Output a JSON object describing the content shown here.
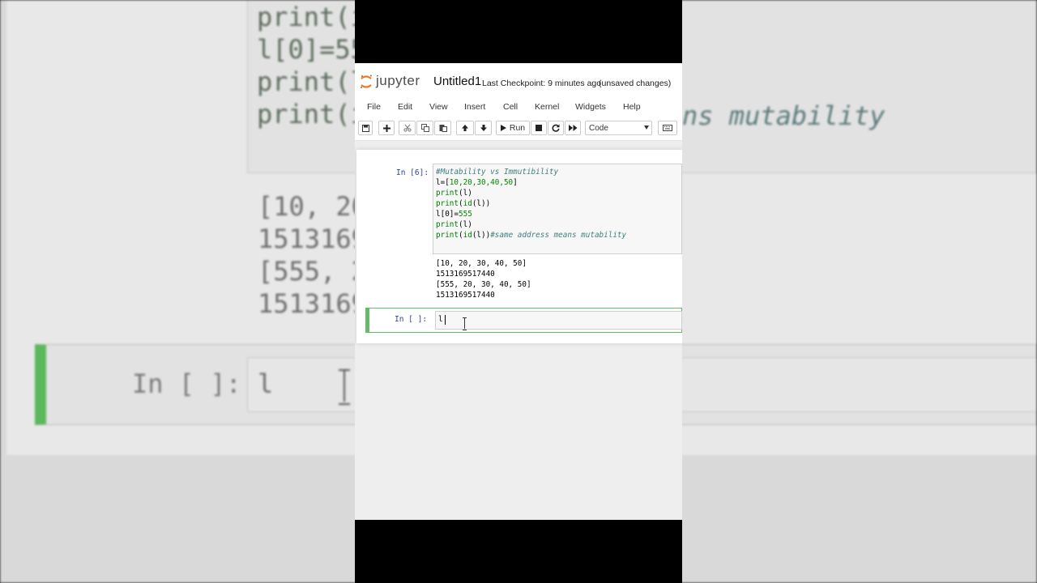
{
  "backdrop": {
    "code_lines": [
      "print(i",
      "l[0]=55",
      "print(l",
      "print(i"
    ],
    "comment_fragment": "ns mutability",
    "output_lines": [
      "[10, 20",
      "1513169",
      "[555, 2",
      "1513169"
    ],
    "prompt": "In [ ]:",
    "input": "l"
  },
  "header": {
    "logo_text": "jupyter",
    "notebook_title": "Untitled1",
    "checkpoint": "Last Checkpoint: 9 minutes ago",
    "status": "(unsaved changes)"
  },
  "menu": [
    "File",
    "Edit",
    "View",
    "Insert",
    "Cell",
    "Kernel",
    "Widgets",
    "Help"
  ],
  "toolbar": {
    "run_label": "Run",
    "cell_type": "Code"
  },
  "cells": [
    {
      "prompt": "In [6]:",
      "code": {
        "line1": "#Mutability vs Immutibility",
        "line2_a": "l=[",
        "line2_nums": "10,20,30,40,50",
        "line2_b": "]",
        "line3_fn": "print",
        "line3_rest": "(l)",
        "line4_fn": "print",
        "line4_mid": "(",
        "line4_fn2": "id",
        "line4_rest": "(l))",
        "line5_a": "l[0]=",
        "line5_num": "555",
        "line6_fn": "print",
        "line6_rest": "(l)",
        "line7_fn": "print",
        "line7_mid": "(",
        "line7_fn2": "id",
        "line7_rest": "(l))",
        "line7_comment": "#same address means mutability"
      },
      "output": [
        "[10, 20, 30, 40, 50]",
        "1513169517440",
        "[555, 20, 30, 40, 50]",
        "1513169517440"
      ]
    },
    {
      "prompt": "In [ ]:",
      "input": "l"
    }
  ]
}
